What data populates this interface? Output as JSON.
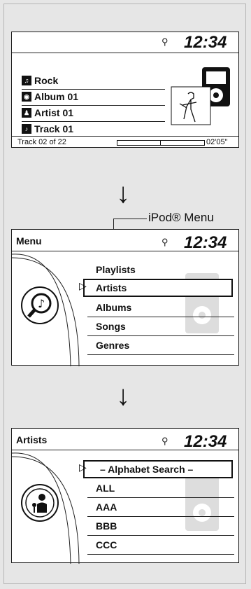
{
  "screen1": {
    "time": "12:34",
    "usb_icon": "usb-icon",
    "items": [
      {
        "icon": "genre-guitar-icon",
        "label": "Rock"
      },
      {
        "icon": "album-disc-icon",
        "label": "Album 01"
      },
      {
        "icon": "artist-icon",
        "label": "Artist 01"
      },
      {
        "icon": "track-note-icon",
        "label": "Track 01"
      }
    ],
    "track_count": "Track 02 of 22",
    "elapsed": "02'05\""
  },
  "callout": {
    "label": "iPod® Menu"
  },
  "screen2": {
    "title": "Menu",
    "time": "12:34",
    "items": [
      "Playlists",
      "Artists",
      "Albums",
      "Songs",
      "Genres"
    ],
    "selected": "Artists"
  },
  "screen3": {
    "title": "Artists",
    "time": "12:34",
    "items": [
      "– Alphabet Search –",
      "ALL",
      "AAA",
      "BBB",
      "CCC"
    ],
    "selected": "– Alphabet Search –"
  },
  "colors": {
    "frame_bg": "#e6e6e6",
    "screen_bg": "#ffffff",
    "ink": "#111111"
  }
}
